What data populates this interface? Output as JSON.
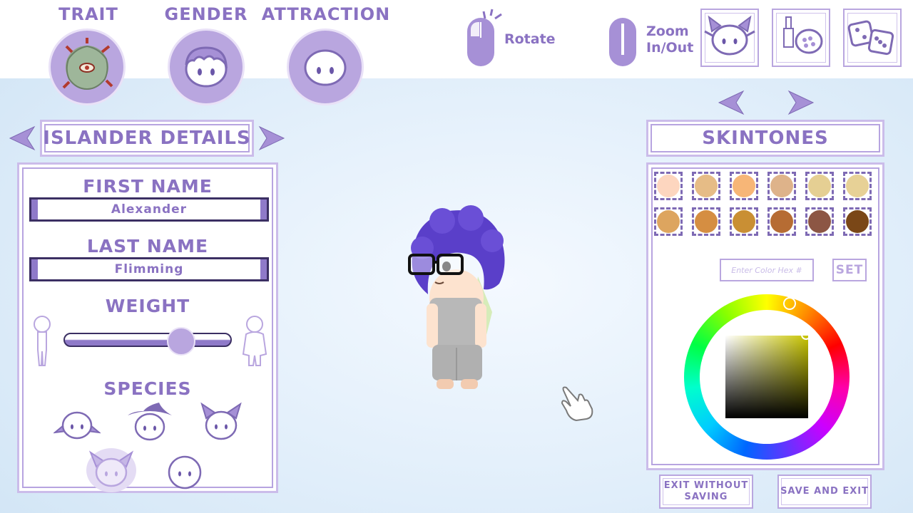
{
  "top_tabs": [
    {
      "label": "TRAIT"
    },
    {
      "label": "GENDER"
    },
    {
      "label": "ATTRACTION"
    }
  ],
  "controls": {
    "rotate_label": "Rotate",
    "zoom_label_line1": "Zoom",
    "zoom_label_line2": "In/Out"
  },
  "toolbar_icons": [
    "head-shape-icon",
    "makeup-icon",
    "dice-icon"
  ],
  "details": {
    "header": "ISLANDER DETAILS",
    "first_name_label": "FIRST NAME",
    "first_name_value": "Alexander",
    "last_name_label": "LAST NAME",
    "last_name_value": "Flimming",
    "weight_label": "WEIGHT",
    "weight_value": 0.73,
    "species_label": "SPECIES",
    "species_options": [
      "elf-ears",
      "witch-hat",
      "cat-ears",
      "fairy",
      "human"
    ],
    "species_selected": "fairy"
  },
  "skintones": {
    "header": "SKINTONES",
    "colors": [
      "#fdd6bf",
      "#e6bc86",
      "#f7b677",
      "#deb38a",
      "#e5cf93",
      "#e7d196",
      "#dda55f",
      "#d58e42",
      "#c98f34",
      "#b66c33",
      "#8c5644",
      "#7a4717"
    ],
    "hex_placeholder": "Enter Color Hex #",
    "set_label": "SET"
  },
  "buttons": {
    "exit_without_saving_line1": "EXIT WITHOUT",
    "exit_without_saving_line2": "SAVING",
    "save_and_exit": "SAVE AND EXIT"
  },
  "colors": {
    "accent": "#8a72c2",
    "accent_light": "#b9a6df",
    "character_hair": "#5a3fc9"
  }
}
